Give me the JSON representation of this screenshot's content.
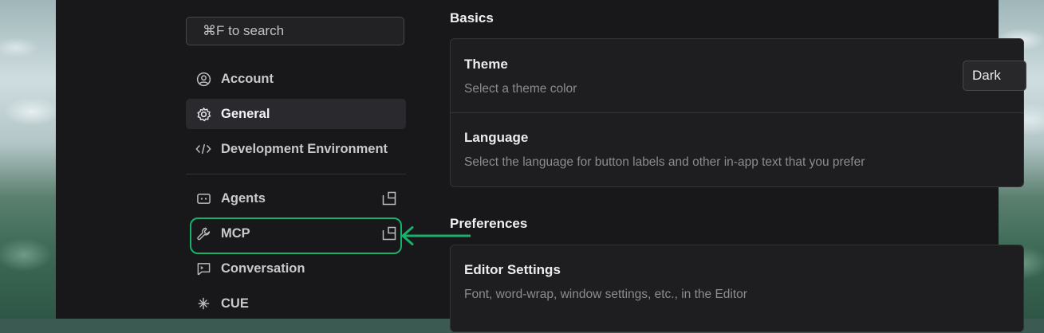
{
  "sidebar": {
    "search_placeholder": "⌘F to search",
    "items": [
      {
        "label": "Account",
        "icon": "account-circle-icon"
      },
      {
        "label": "General",
        "icon": "gear-icon",
        "active": true
      },
      {
        "label": "Development Environment",
        "icon": "code-icon"
      },
      {
        "label": "Agents",
        "icon": "agent-icon",
        "external": true
      },
      {
        "label": "MCP",
        "icon": "wrench-icon",
        "external": true
      },
      {
        "label": "Conversation",
        "icon": "chat-icon"
      },
      {
        "label": "CUE",
        "icon": "cue-icon"
      }
    ]
  },
  "main": {
    "basics": {
      "title": "Basics",
      "theme": {
        "title": "Theme",
        "description": "Select a theme color",
        "value": "Dark"
      },
      "language": {
        "title": "Language",
        "description": "Select the language for button labels and other in-app text that you prefer"
      }
    },
    "preferences": {
      "title": "Preferences",
      "editor": {
        "title": "Editor Settings",
        "description": "Font, word-wrap, window settings, etc., in the Editor"
      }
    }
  },
  "annotation": {
    "highlight_color": "#19b06c",
    "target": "MCP"
  },
  "colors": {
    "window_bg": "#18181a",
    "card_bg": "#1e1e21",
    "active_item_bg": "#2a2a2e"
  }
}
